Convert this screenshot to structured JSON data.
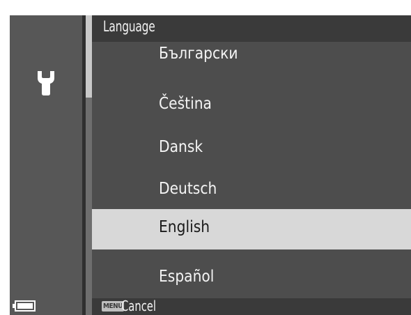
{
  "header": {
    "title": "Language"
  },
  "menu": {
    "items": [
      {
        "label": "Български",
        "selected": false
      },
      {
        "label": "Čeština",
        "selected": false
      },
      {
        "label": "Dansk",
        "selected": false
      },
      {
        "label": "Deutsch",
        "selected": false
      },
      {
        "label": "English",
        "selected": true
      },
      {
        "label": "Español",
        "selected": false
      }
    ]
  },
  "sidebar": {
    "icon": "wrench-icon",
    "status_icon": "battery-icon"
  },
  "footer": {
    "menu_key": "MENU",
    "cancel_label": "Cancel"
  },
  "colors": {
    "background": "#4d4d4d",
    "title_bar": "#3a3a3a",
    "selected_row": "#d8d8d8",
    "text": "#f4f4f4"
  }
}
